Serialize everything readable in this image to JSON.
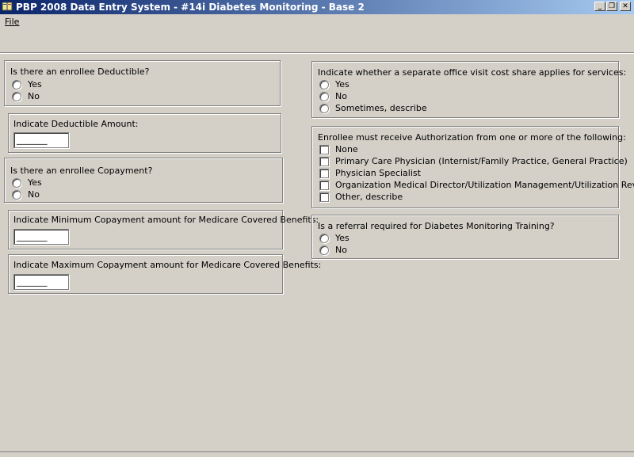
{
  "window": {
    "title": "PBP 2008 Data Entry System - #14i Diabetes Monitoring - Base 2",
    "minimize": "_",
    "restore": "❐",
    "close": "✕"
  },
  "menu": {
    "file": "File"
  },
  "left": {
    "deductible": {
      "question": "Is there an enrollee Deductible?",
      "yes": "Yes",
      "no": "No"
    },
    "deductible_amount": {
      "label": "Indicate Deductible Amount:",
      "value": "_______"
    },
    "copayment": {
      "question": "Is there an enrollee Copayment?",
      "yes": "Yes",
      "no": "No"
    },
    "min_copay": {
      "label": "Indicate Minimum Copayment amount for Medicare Covered Benefits:",
      "value": "_______"
    },
    "max_copay": {
      "label": "Indicate Maximum Copayment amount for Medicare Covered Benefits:",
      "value": "_______"
    }
  },
  "right": {
    "office_visit": {
      "question": "Indicate whether a separate office visit cost share applies for services:",
      "options": [
        "Yes",
        "No",
        "Sometimes, describe"
      ]
    },
    "authorization": {
      "question": "Enrollee must receive Authorization from one or more of the following:",
      "options": [
        "None",
        "Primary Care Physician (Internist/Family Practice, General Practice)",
        "Physician Specialist",
        "Organization Medical Director/Utilization Management/Utilization Review",
        "Other, describe"
      ]
    },
    "referral": {
      "question": "Is a referral required for Diabetes Monitoring Training?",
      "yes": "Yes",
      "no": "No"
    }
  },
  "icons": {
    "app": "app-book-icon"
  }
}
